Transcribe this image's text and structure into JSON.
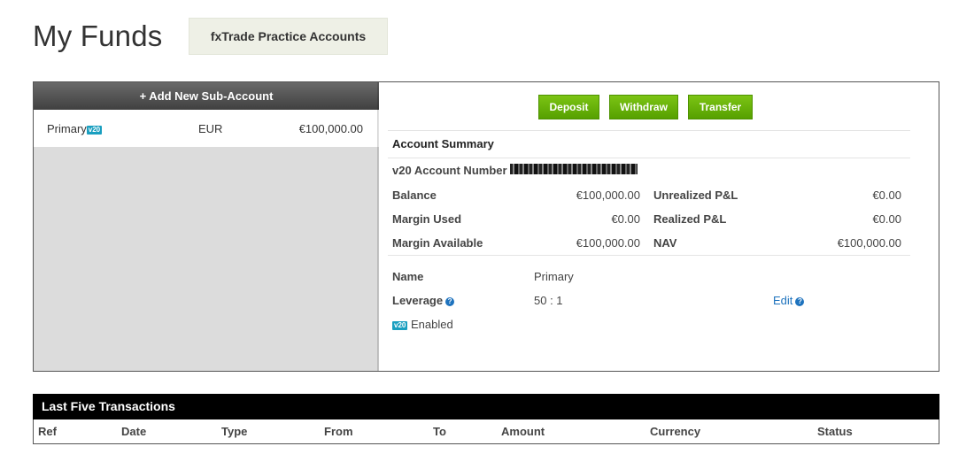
{
  "page": {
    "title": "My Funds",
    "account_type_tab": "fxTrade Practice Accounts"
  },
  "sub_accounts": {
    "add_label": "+ Add New Sub-Account",
    "items": [
      {
        "name": "Primary",
        "badge": "v20",
        "currency": "EUR",
        "balance": "€100,000.00"
      }
    ]
  },
  "actions": {
    "deposit": "Deposit",
    "withdraw": "Withdraw",
    "transfer": "Transfer"
  },
  "summary": {
    "title": "Account Summary",
    "account_number_label": "v20 Account Number",
    "balance_label": "Balance",
    "balance_value": "€100,000.00",
    "margin_used_label": "Margin Used",
    "margin_used_value": "€0.00",
    "margin_available_label": "Margin Available",
    "margin_available_value": "€100,000.00",
    "unrealized_pl_label": "Unrealized P&L",
    "unrealized_pl_value": "€0.00",
    "realized_pl_label": "Realized P&L",
    "realized_pl_value": "€0.00",
    "nav_label": "NAV",
    "nav_value": "€100,000.00"
  },
  "details": {
    "name_label": "Name",
    "name_value": "Primary",
    "leverage_label": "Leverage",
    "leverage_value": "50 : 1",
    "edit_label": "Edit",
    "v20_badge": "v20",
    "enabled_label": "Enabled"
  },
  "transactions": {
    "title": "Last Five Transactions",
    "columns": [
      "Ref",
      "Date",
      "Type",
      "From",
      "To",
      "Amount",
      "Currency",
      "Status"
    ]
  },
  "colors": {
    "action_green": "#6bb80c",
    "v20_badge": "#1a9fc0",
    "link_blue": "#1e73be"
  }
}
